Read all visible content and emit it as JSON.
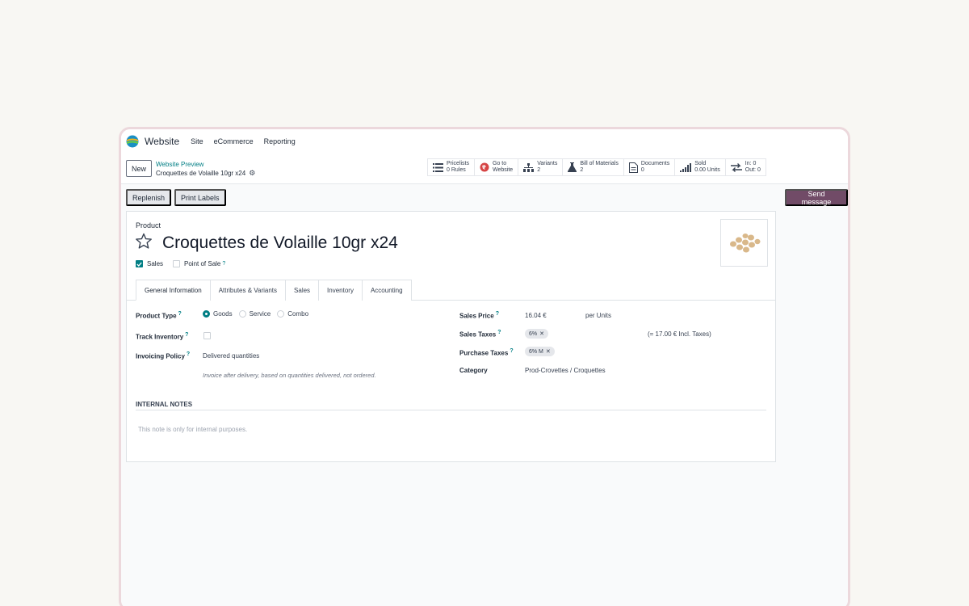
{
  "app": {
    "name": "Website",
    "menu": [
      "Site",
      "eCommerce",
      "Reporting"
    ]
  },
  "control": {
    "new_label": "New",
    "breadcrumb_parent": "Website Preview",
    "breadcrumb_current": "Croquettes de Volaille 10gr x24"
  },
  "smart_buttons": [
    {
      "icon": "list-icon",
      "line1": "Pricelists",
      "line2": "0 Rules"
    },
    {
      "icon": "globe-icon",
      "line1": "Go to",
      "line2": "Website"
    },
    {
      "icon": "sitemap-icon",
      "line1": "Variants",
      "line2": "2"
    },
    {
      "icon": "flask-icon",
      "line1": "Bill of Materials",
      "line2": "2"
    },
    {
      "icon": "file-icon",
      "line1": "Documents",
      "line2": "0"
    },
    {
      "icon": "bar-chart-icon",
      "line1": "Sold",
      "line2": "0.00 Units"
    },
    {
      "icon": "exchange-icon",
      "line1": "In: 0",
      "line2": "Out: 0"
    }
  ],
  "actions": {
    "replenish": "Replenish",
    "print_labels": "Print Labels",
    "send_message": "Send message"
  },
  "product": {
    "label": "Product",
    "name": "Croquettes de Volaille 10gr x24",
    "sales_label": "Sales",
    "sales_checked": true,
    "pos_label": "Point of Sale",
    "pos_checked": false,
    "help_mark": "?"
  },
  "tabs": [
    "General Information",
    "Attributes & Variants",
    "Sales",
    "Inventory",
    "Accounting"
  ],
  "general": {
    "product_type_label": "Product Type",
    "product_type_options": [
      "Goods",
      "Service",
      "Combo"
    ],
    "product_type_selected": "Goods",
    "track_inventory_label": "Track Inventory",
    "invoicing_policy_label": "Invoicing Policy",
    "invoicing_policy_value": "Delivered quantities",
    "invoicing_policy_hint": "Invoice after delivery, based on quantities delivered, not ordered.",
    "sales_price_label": "Sales Price",
    "sales_price_value": "16.04 €",
    "sales_price_unit": "per Units",
    "sales_taxes_label": "Sales Taxes",
    "sales_taxes_tag": "6%",
    "sales_taxes_incl": "(= 17.00 € Incl. Taxes)",
    "purchase_taxes_label": "Purchase Taxes",
    "purchase_taxes_tag": "6% M",
    "category_label": "Category",
    "category_value": "Prod-Crovettes / Croquettes"
  },
  "notes": {
    "title": "INTERNAL NOTES",
    "placeholder": "This note is only for internal purposes."
  },
  "colors": {
    "accent": "#714b67",
    "teal": "#017e84"
  }
}
